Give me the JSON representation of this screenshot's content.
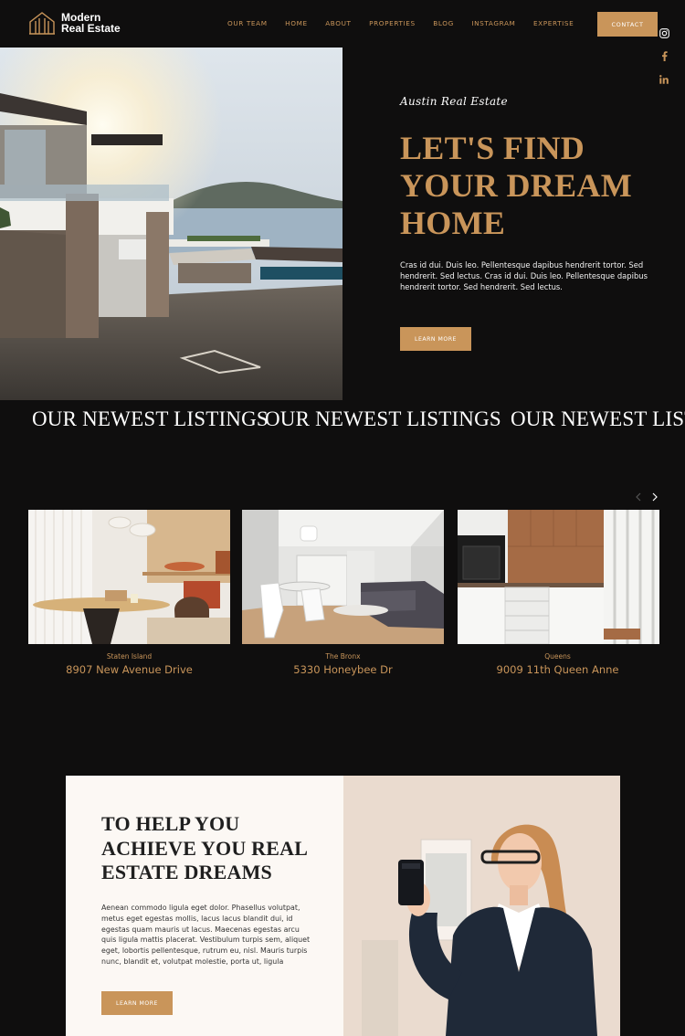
{
  "brand": {
    "line1": "Modern",
    "line2": "Real Estate"
  },
  "nav": [
    "OUR TEAM",
    "HOME",
    "ABOUT",
    "PROPERTIES",
    "BLOG",
    "INSTAGRAM",
    "EXPERTISE"
  ],
  "contact_label": "CONTACT",
  "social": [
    "instagram-icon",
    "facebook-icon",
    "linkedin-icon"
  ],
  "hero": {
    "script_title": "Austin Real Estate",
    "title": "LET'S FIND YOUR DREAM HOME",
    "body": "Cras id dui. Duis leo. Pellentesque dapibus hendrerit tortor. Sed hendrerit. Sed lectus. Cras id dui. Duis leo. Pellentesque dapibus hendrerit tortor. Sed hendrerit. Sed lectus.",
    "button": "LEARN MORE"
  },
  "marquee": "OUR NEWEST LISTINGS",
  "listings": [
    {
      "borough": "Staten Island",
      "address": "8907 New Avenue Drive"
    },
    {
      "borough": "The Bronx",
      "address": "5330 Honeybee Dr"
    },
    {
      "borough": "Queens",
      "address": "9009 11th Queen Anne"
    }
  ],
  "about": {
    "title": "TO HELP YOU ACHIEVE YOU REAL ESTATE DREAMS",
    "body": "Aenean commodo ligula eget dolor. Phasellus volutpat, metus eget egestas mollis, lacus lacus blandit dui, id egestas quam mauris ut lacus. Maecenas egestas arcu quis  ligula mattis placerat. Vestibulum turpis sem, aliquet eget, lobortis pellentesque, rutrum eu, nisl. Mauris turpis nunc, blandit et, volutpat molestie, porta ut, ligula",
    "button": "LEARN MORE"
  },
  "colors": {
    "accent": "#c9955a",
    "background": "#0f0e0e",
    "panel": "#fcf8f4"
  }
}
